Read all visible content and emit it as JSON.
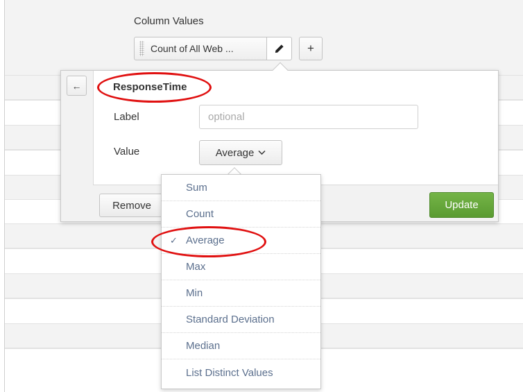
{
  "column_values": {
    "title": "Column Values",
    "chip_label": "Count of All Web ...",
    "edit_icon": "pencil-icon",
    "add_label": "+"
  },
  "editor": {
    "back_label": "←",
    "field_name": "ResponseTime",
    "label_caption": "Label",
    "label_placeholder": "optional",
    "value_caption": "Value",
    "value_selected": "Average",
    "remove_label": "Remove",
    "update_label": "Update",
    "update_color": "#5fa235"
  },
  "dropdown": {
    "options": [
      {
        "label": "Sum",
        "selected": false
      },
      {
        "label": "Count",
        "selected": false
      },
      {
        "label": "Average",
        "selected": true
      },
      {
        "label": "Max",
        "selected": false
      },
      {
        "label": "Min",
        "selected": false
      },
      {
        "label": "Standard Deviation",
        "selected": false
      },
      {
        "label": "Median",
        "selected": false
      },
      {
        "label": "List Distinct Values",
        "selected": false
      }
    ],
    "check_mark": "✓"
  },
  "annotation_color": "#e01010"
}
